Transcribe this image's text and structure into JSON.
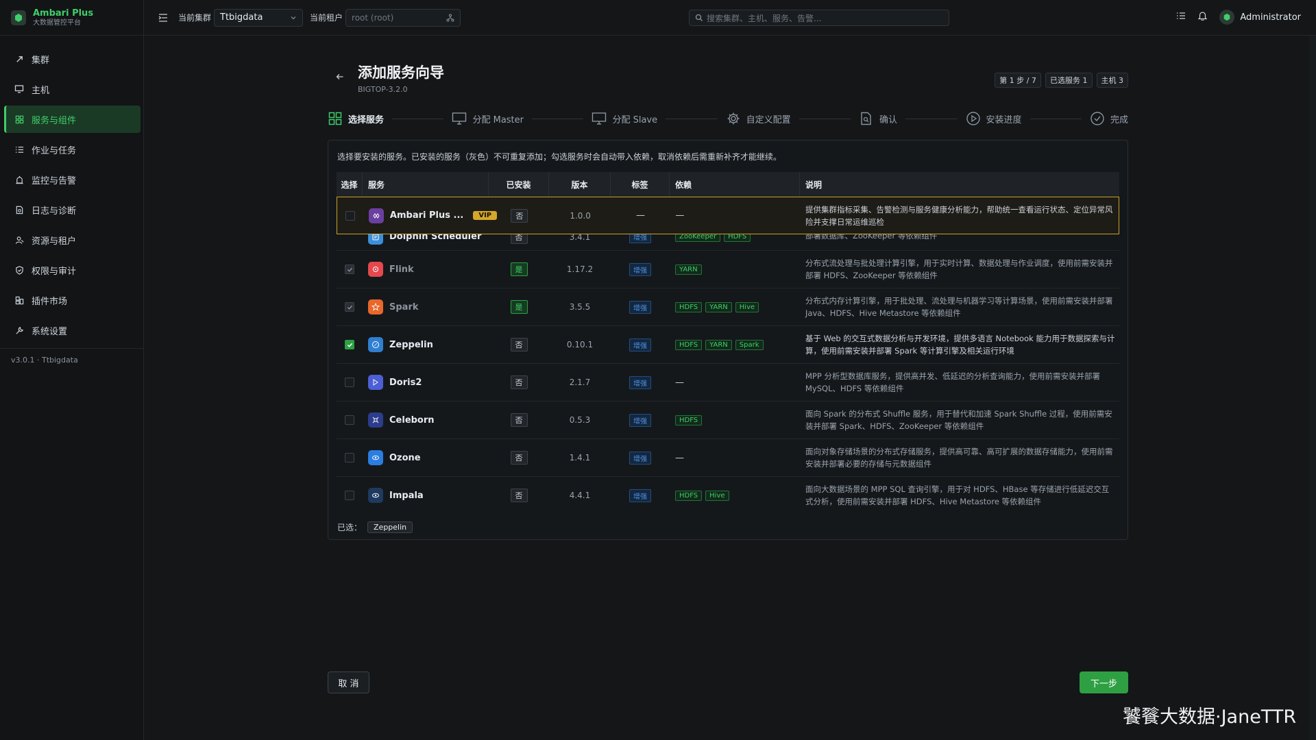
{
  "brand": {
    "title": "Ambari Plus",
    "subtitle": "大数据管控平台"
  },
  "sidebar": {
    "items": [
      {
        "label": "集群",
        "icon": "rocket-icon"
      },
      {
        "label": "主机",
        "icon": "monitor-icon"
      },
      {
        "label": "服务与组件",
        "icon": "grid-icon",
        "active": true
      },
      {
        "label": "作业与任务",
        "icon": "list-icon"
      },
      {
        "label": "监控与告警",
        "icon": "alarm-icon"
      },
      {
        "label": "日志与诊断",
        "icon": "log-icon"
      },
      {
        "label": "资源与租户",
        "icon": "tenant-icon"
      },
      {
        "label": "权限与审计",
        "icon": "shield-icon"
      },
      {
        "label": "插件市场",
        "icon": "plugin-icon"
      },
      {
        "label": "系统设置",
        "icon": "wrench-icon"
      }
    ],
    "version": "v3.0.1 · Ttbigdata"
  },
  "topbar": {
    "cluster_label": "当前集群",
    "cluster_value": "Ttbigdata",
    "tenant_label": "当前租户",
    "tenant_placeholder": "root (root)",
    "search_placeholder": "搜索集群、主机、服务、告警...",
    "user_name": "Administrator"
  },
  "wizard": {
    "title": "添加服务向导",
    "subtitle": "BIGTOP-3.2.0",
    "badges": [
      "第 1 步 / 7",
      "已选服务 1",
      "主机 3"
    ],
    "steps": [
      {
        "label": "选择服务",
        "icon": "grid-icon",
        "active": true
      },
      {
        "label": "分配 Master",
        "icon": "monitor-icon"
      },
      {
        "label": "分配 Slave",
        "icon": "monitor-icon"
      },
      {
        "label": "自定义配置",
        "icon": "gear-icon"
      },
      {
        "label": "确认",
        "icon": "doc-search-icon"
      },
      {
        "label": "安装进度",
        "icon": "play-circle-icon"
      },
      {
        "label": "完成",
        "icon": "check-circle-icon"
      }
    ],
    "hint": "选择要安装的服务。已安装的服务（灰色）不可重复添加；勾选服务时会自动带入依赖，取消依赖后需重新补齐才能继续。",
    "columns": [
      "选择",
      "服务",
      "已安装",
      "版本",
      "标签",
      "依赖",
      "说明"
    ],
    "rows": [
      {
        "name": "Ambari Plus ...",
        "vip": "VIP",
        "installed": "否",
        "version": "1.0.0",
        "tag": "—",
        "deps": [],
        "deps_dash": "—",
        "desc": "提供集群指标采集、告警检测与服务健康分析能力，帮助统一查看运行状态、定位异常风险并支撑日常运维巡检",
        "icon_color": "#6b3fa0",
        "state": "unchecked"
      },
      {
        "name": "Dolphin Scheduler",
        "installed": "否",
        "version": "3.4.1",
        "tag": "增强",
        "deps": [
          "ZooKeeper",
          "HDFS"
        ],
        "desc": "分布式可视化工作流调度系统，用于调度 Spark、Flink、Shell 等任务，使用前需安装并部署数据库、ZooKeeper 等依赖组件",
        "icon_color": "#3a8fd9",
        "state": "unchecked"
      },
      {
        "name": "Flink",
        "installed": "是",
        "version": "1.17.2",
        "tag": "增强",
        "deps": [
          "YARN"
        ],
        "desc": "分布式流处理与批处理计算引擎，用于实时计算、数据处理与作业调度，使用前需安装并部署 HDFS、ZooKeeper 等依赖组件",
        "icon_color": "#e5484d",
        "state": "disabled"
      },
      {
        "name": "Spark",
        "installed": "是",
        "version": "3.5.5",
        "tag": "增强",
        "deps": [
          "HDFS",
          "YARN",
          "Hive"
        ],
        "desc": "分布式内存计算引擎，用于批处理、流处理与机器学习等计算场景，使用前需安装并部署 Java、HDFS、Hive Metastore 等依赖组件",
        "icon_color": "#e8672a",
        "state": "disabled"
      },
      {
        "name": "Zeppelin",
        "installed": "否",
        "version": "0.10.1",
        "tag": "增强",
        "deps": [
          "HDFS",
          "YARN",
          "Spark"
        ],
        "desc": "基于 Web 的交互式数据分析与开发环境，提供多语言 Notebook 能力用于数据探索与计算，使用前需安装并部署 Spark 等计算引擎及相关运行环境",
        "icon_color": "#2f7fd1",
        "state": "checked"
      },
      {
        "name": "Doris2",
        "installed": "否",
        "version": "2.1.7",
        "tag": "增强",
        "deps": [],
        "deps_dash": "—",
        "desc": "MPP 分析型数据库服务，提供高并发、低延迟的分析查询能力，使用前需安装并部署 MySQL、HDFS 等依赖组件",
        "icon_color": "#4c5fd5",
        "state": "unchecked"
      },
      {
        "name": "Celeborn",
        "installed": "否",
        "version": "0.5.3",
        "tag": "增强",
        "deps": [
          "HDFS"
        ],
        "desc": "面向 Spark 的分布式 Shuffle 服务，用于替代和加速 Spark Shuffle 过程，使用前需安装并部署 Spark、HDFS、ZooKeeper 等依赖组件",
        "icon_color": "#2d3c8c",
        "state": "unchecked"
      },
      {
        "name": "Ozone",
        "installed": "否",
        "version": "1.4.1",
        "tag": "增强",
        "deps": [],
        "deps_dash": "—",
        "desc": "面向对象存储场景的分布式存储服务，提供高可靠、高可扩展的数据存储能力，使用前需安装并部署必要的存储与元数据组件",
        "icon_color": "#2b7de0",
        "state": "unchecked"
      },
      {
        "name": "Impala",
        "installed": "否",
        "version": "4.4.1",
        "tag": "增强",
        "deps": [
          "HDFS",
          "Hive"
        ],
        "desc": "面向大数据场景的 MPP SQL 查询引擎，用于对 HDFS、HBase 等存储进行低延迟交互式分析，使用前需安装并部署 HDFS、Hive Metastore 等依赖组件",
        "icon_color": "#1e3a5f",
        "state": "unchecked"
      }
    ],
    "selected_label": "已选：",
    "selected_items": [
      "Zeppelin"
    ],
    "cancel_label": "取 消",
    "next_label": "下一步"
  },
  "watermark": "饕餮大数据·JaneTTR"
}
